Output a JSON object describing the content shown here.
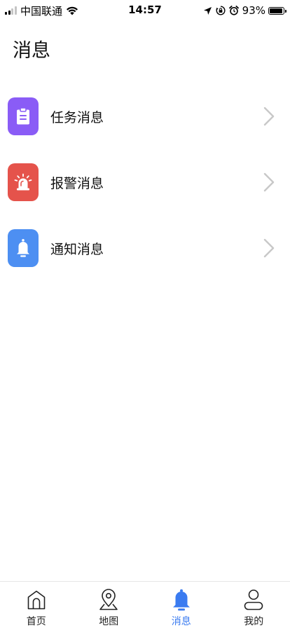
{
  "status_bar": {
    "carrier": "中国联通",
    "time": "14:57",
    "battery_percent": "93%",
    "battery_level": 0.93,
    "signal_bars_active": 2,
    "signal_bars_total": 4,
    "icons": [
      "wifi-icon",
      "location-arrow-icon",
      "orientation-lock-icon",
      "alarm-icon"
    ]
  },
  "page": {
    "title": "消息"
  },
  "messages": {
    "items": [
      {
        "label": "任务消息",
        "icon": "clipboard-icon",
        "color": "#8a5cf6"
      },
      {
        "label": "报警消息",
        "icon": "siren-icon",
        "color": "#e5534b"
      },
      {
        "label": "通知消息",
        "icon": "bell-icon",
        "color": "#4d8ff2"
      }
    ],
    "chevron_color": "#c8c8c8"
  },
  "tab_bar": {
    "active_index": 2,
    "active_color": "#3a7bf0",
    "items": [
      {
        "label": "首页",
        "icon": "home-icon"
      },
      {
        "label": "地图",
        "icon": "map-pin-icon"
      },
      {
        "label": "消息",
        "icon": "bell-icon"
      },
      {
        "label": "我的",
        "icon": "user-icon"
      }
    ]
  }
}
